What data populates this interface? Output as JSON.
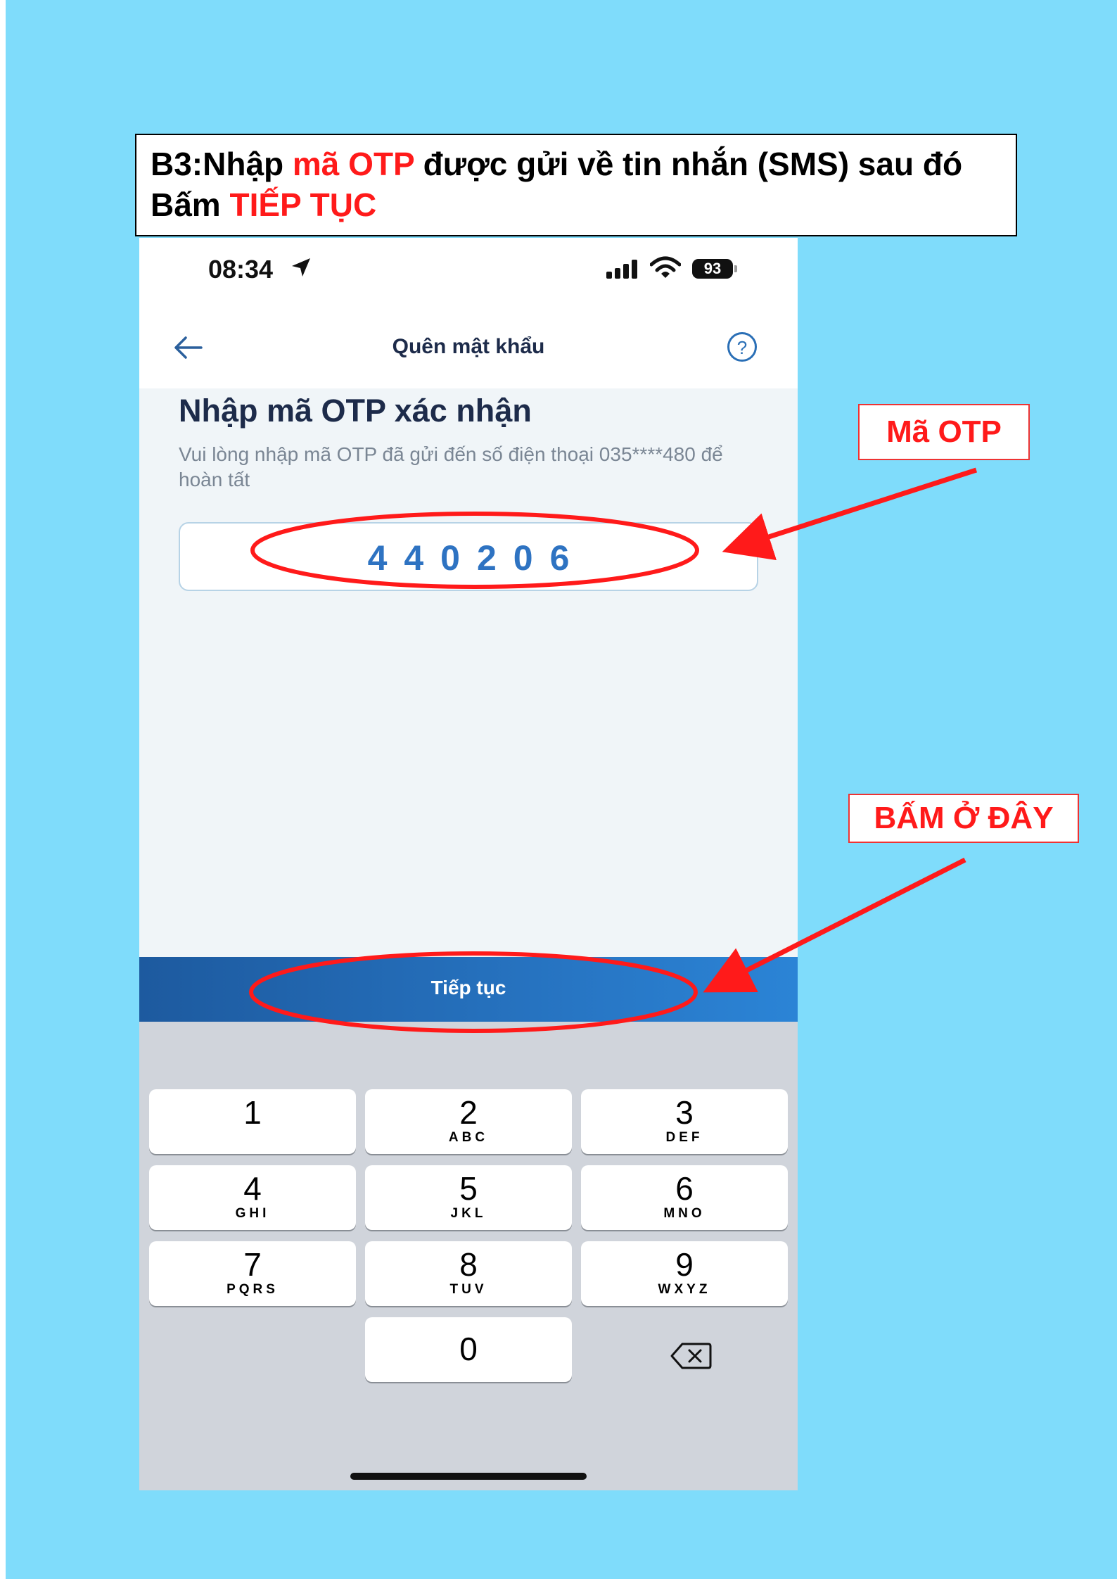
{
  "instruction": {
    "prefix": "B3:Nhập ",
    "highlight1": "mã OTP",
    "middle": " được gửi về tin nhắn (SMS) sau đó",
    "line2_prefix": "Bấm ",
    "highlight2": "TIẾP TỤC"
  },
  "status_bar": {
    "time": "08:34",
    "battery": "93",
    "icons": [
      "location-arrow-icon",
      "signal-icon",
      "wifi-icon",
      "battery-icon"
    ]
  },
  "nav": {
    "title": "Quên mật khẩu",
    "help": "?",
    "icons": [
      "back-arrow-icon",
      "help-icon"
    ]
  },
  "otp": {
    "heading": "Nhập mã OTP xác nhận",
    "instruction": "Vui lòng nhập mã OTP đã gửi đến số điện thoại 035****480 để hoàn tất",
    "value": "440206"
  },
  "continue_button": {
    "label": "Tiếp tục"
  },
  "keypad": {
    "keys": [
      {
        "digit": "1",
        "letters": ""
      },
      {
        "digit": "2",
        "letters": "ABC"
      },
      {
        "digit": "3",
        "letters": "DEF"
      },
      {
        "digit": "4",
        "letters": "GHI"
      },
      {
        "digit": "5",
        "letters": "JKL"
      },
      {
        "digit": "6",
        "letters": "MNO"
      },
      {
        "digit": "7",
        "letters": "PQRS"
      },
      {
        "digit": "8",
        "letters": "TUV"
      },
      {
        "digit": "9",
        "letters": "WXYZ"
      },
      {
        "digit": "0",
        "letters": ""
      }
    ],
    "backspace_icon": "backspace-icon"
  },
  "callouts": {
    "otp": "Mã OTP",
    "press_here": "BẤM Ở ĐÂY"
  },
  "colors": {
    "page_background": "#7fdcfb",
    "annotation_red": "#ff1a1a",
    "button_blue": "#1d5a9f",
    "otp_blue": "#2e73c2"
  }
}
